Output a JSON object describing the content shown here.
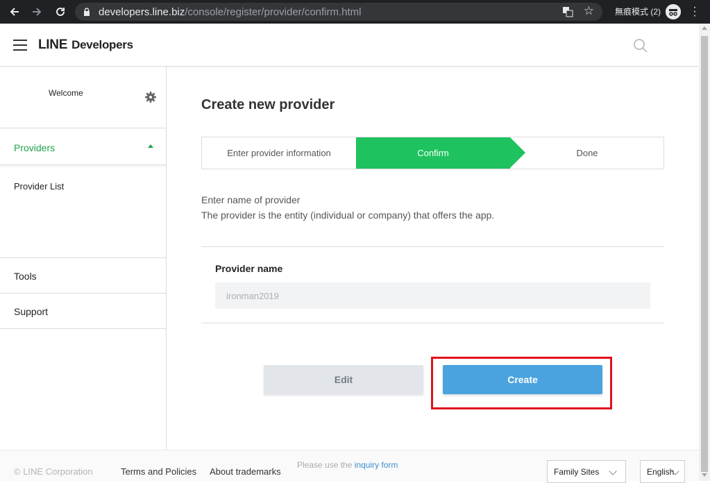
{
  "browser": {
    "url_host": "developers.line.biz",
    "url_path": "/console/register/provider/confirm.html",
    "incognito_label": "無痕模式 (2)"
  },
  "header": {
    "logo_line": "LINE",
    "logo_dev": "Developers"
  },
  "sidebar": {
    "welcome": "Welcome",
    "section_providers": "Providers",
    "provider_list": "Provider List",
    "tools": "Tools",
    "support": "Support"
  },
  "main": {
    "title": "Create new provider",
    "steps": [
      "Enter provider information",
      "Confirm",
      "Done"
    ],
    "active_step": 1,
    "desc_line1": "Enter name of provider",
    "desc_line2": "The provider is the entity (individual or company) that offers the app.",
    "field_label": "Provider name",
    "field_value": "ironman2019",
    "edit_label": "Edit",
    "create_label": "Create"
  },
  "footer": {
    "copyright": "©  LINE Corporation",
    "terms": "Terms and Policies",
    "trademarks": "About trademarks",
    "inquiry_prefix": "Please use the ",
    "inquiry_link": "inquiry form",
    "family_sites": "Family Sites",
    "language": "English"
  },
  "colors": {
    "accent_green": "#1ec35f",
    "create_blue": "#4aa3df",
    "highlight_red": "#e0121c"
  }
}
